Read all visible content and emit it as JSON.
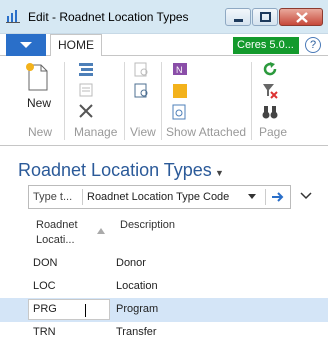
{
  "window": {
    "title": "Edit - Roadnet Location Types"
  },
  "ribbon": {
    "tab": "HOME",
    "company": "Ceres 5.0...",
    "help": "?",
    "new_label": "New",
    "groups": [
      "New",
      "Manage",
      "View",
      "Show Attached",
      "Page"
    ]
  },
  "page": {
    "title": "Roadnet Location Types"
  },
  "filter": {
    "placeholder": "Type t...",
    "field": "Roadnet Location Type Code"
  },
  "table": {
    "headers": {
      "code_line1": "Roadnet",
      "code_line2": "Locati...",
      "description": "Description"
    },
    "rows": [
      {
        "code": "DON",
        "description": "Donor"
      },
      {
        "code": "LOC",
        "description": "Location"
      },
      {
        "code": "PRG",
        "description": "Program"
      },
      {
        "code": "TRN",
        "description": "Transfer"
      }
    ]
  },
  "colors": {
    "accent": "#2a6fc9",
    "title": "#2b5a99",
    "company_badge": "#139a2c",
    "selection": "#d4e5f7"
  }
}
